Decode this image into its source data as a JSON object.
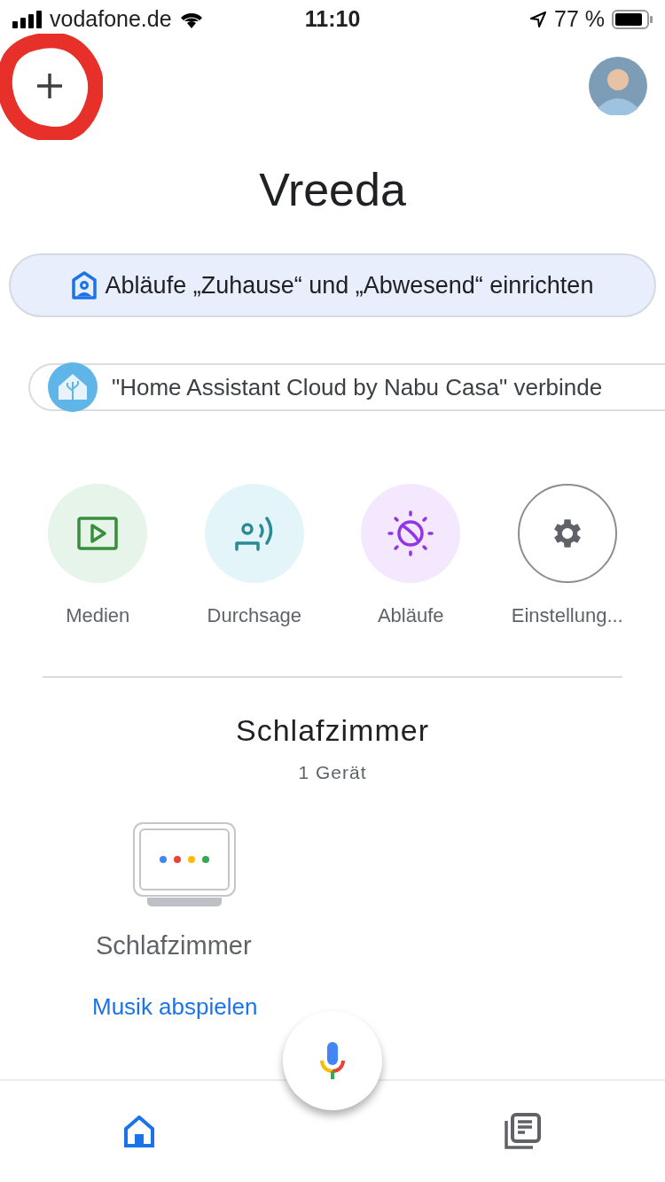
{
  "status_bar": {
    "carrier": "vodafone.de",
    "time": "11:10",
    "battery": "77 %"
  },
  "home": {
    "title": "Vreeda"
  },
  "chips": [
    {
      "kind": "routine",
      "label": "Abläufe „Zuhause“ und „Abwesend“ einrichten"
    },
    {
      "kind": "service",
      "label": "\"Home Assistant Cloud by Nabu Casa\" verbinde"
    }
  ],
  "actions": [
    {
      "kind": "media",
      "label": "Medien"
    },
    {
      "kind": "broadcast",
      "label": "Durchsage"
    },
    {
      "kind": "routines",
      "label": "Abläufe"
    },
    {
      "kind": "settings",
      "label": "Einstellung..."
    }
  ],
  "room": {
    "name": "Schlafzimmer",
    "count": "1 Gerät",
    "devices": [
      {
        "name": "Schlafzimmer",
        "action": "Musik abspielen"
      }
    ]
  },
  "bottom_nav": [
    {
      "kind": "home",
      "selected": true
    },
    {
      "kind": "feed",
      "selected": false
    }
  ]
}
